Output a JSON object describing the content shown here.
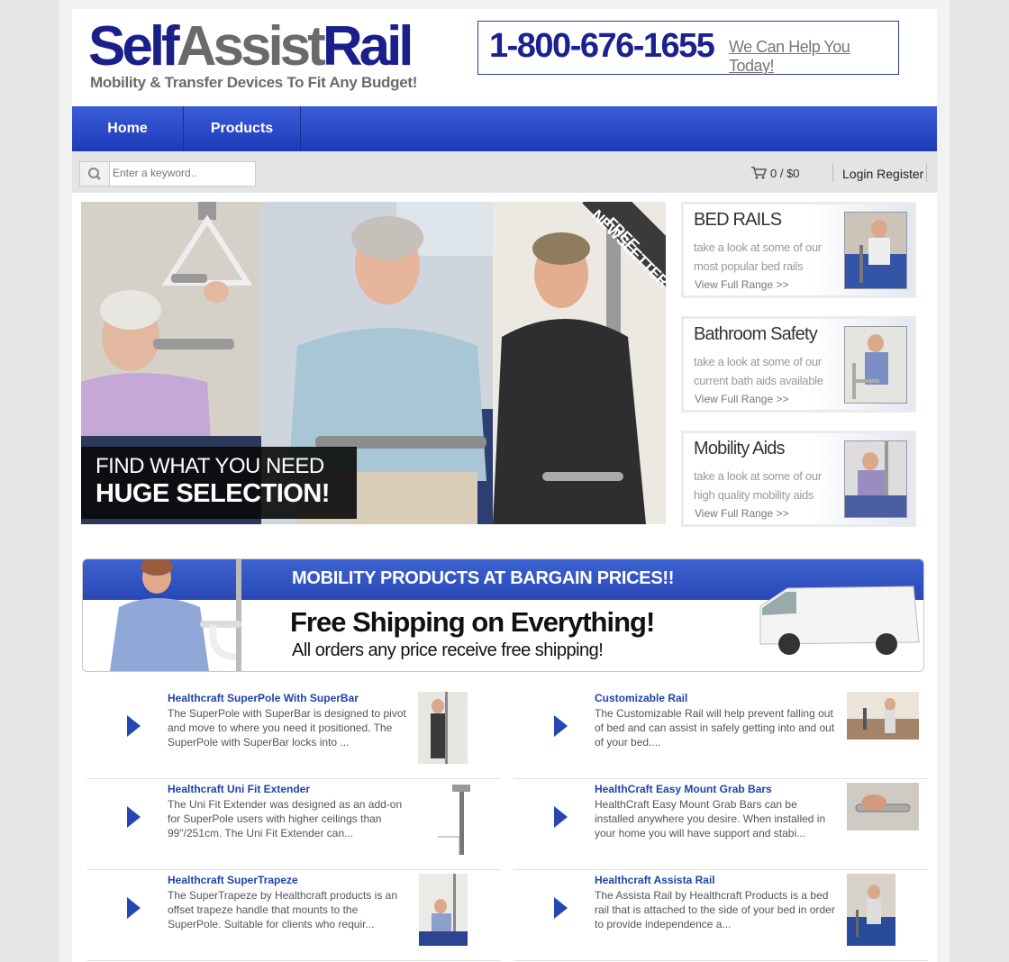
{
  "header": {
    "logo": {
      "part1": "Self",
      "part2": "Assist",
      "part3": "Rail"
    },
    "tagline": "Mobility & Transfer Devices To Fit Any Budget!",
    "phone": "1-800-676-1655",
    "help_text": "We Can Help You Today!"
  },
  "nav": {
    "items": [
      {
        "label": "Home"
      },
      {
        "label": "Products"
      }
    ]
  },
  "toolbar": {
    "search_placeholder": "Enter a keyword..",
    "cart_text": "0 / $0",
    "login_label": "Login",
    "register_label": "Register"
  },
  "hero": {
    "overlay_line1": "FIND WHAT YOU NEED",
    "overlay_line2": "HUGE SELECTION!",
    "ribbon_line1": "FREE",
    "ribbon_line2": "NEWSLETTER"
  },
  "promos": [
    {
      "title": "BED RAILS",
      "text": "take a look at some of our most popular bed rails",
      "link": "View Full Range >>"
    },
    {
      "title": "Bathroom Safety",
      "text": "take a look at some of our current bath aids available",
      "link": "View Full Range >>"
    },
    {
      "title": "Mobility Aids",
      "text": "take a look at some of our high quality mobility aids",
      "link": "View Full Range >>"
    }
  ],
  "banner": {
    "line1": "MOBILITY PRODUCTS AT BARGAIN PRICES!!",
    "line2": "Free Shipping on Everything!",
    "line3": "All orders any price receive free shipping!"
  },
  "products": [
    {
      "title": "Healthcraft SuperPole With SuperBar",
      "desc": "The SuperPole with SuperBar is designed to pivot and move to where you need it positioned. The SuperPole with SuperBar locks into ..."
    },
    {
      "title": "Customizable Rail",
      "desc": "The Customizable Rail will help prevent falling out of bed and can assist in safely getting into and out of your bed...."
    },
    {
      "title": "Healthcraft Uni Fit Extender",
      "desc": "The Uni Fit Extender was designed as an add-on for SuperPole users with higher ceilings than 99\"/251cm. The Uni Fit Extender can..."
    },
    {
      "title": "HealthCraft Easy Mount Grab Bars",
      "desc": "HealthCraft Easy Mount Grab Bars can be installed anywhere you desire. When installed in your home you will have support and stabi..."
    },
    {
      "title": "Healthcraft SuperTrapeze",
      "desc": "The SuperTrapeze by Healthcraft products is an offset trapeze handle that mounts to the SuperPole. Suitable for clients who requir..."
    },
    {
      "title": "Healthcraft Assista Rail",
      "desc": "The Assista Rail by Healthcraft Products is a bed rail that is attached to the side of your bed in order to provide independence a..."
    }
  ]
}
